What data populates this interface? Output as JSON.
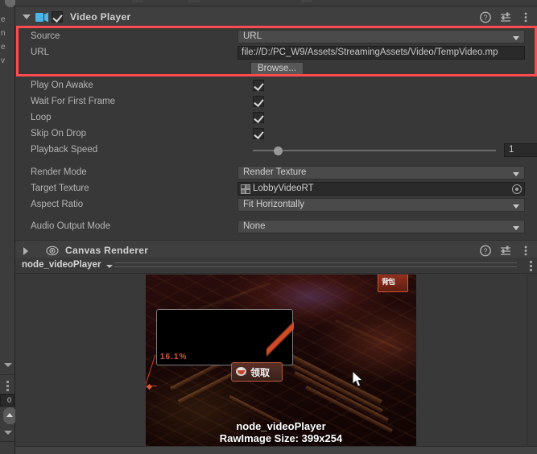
{
  "window": {
    "panel": "inspector",
    "left_strip_letters": [
      "e",
      "n",
      "e",
      "v"
    ],
    "left_strip_value": "0"
  },
  "video_player": {
    "title": "Video Player",
    "enabled": true,
    "icon": "video-player-icon",
    "header_icons": [
      "help-icon",
      "preset-icon",
      "more-menu-icon"
    ],
    "rows": [
      {
        "label": "Source",
        "type": "dropdown",
        "value": "URL"
      },
      {
        "label": "URL",
        "type": "text",
        "value": "file://D:/PC_W9/Assets/StreamingAssets/Video/TempVideo.mp"
      },
      {
        "label": "",
        "type": "button",
        "value": "Browse..."
      },
      {
        "label": "Play On Awake",
        "type": "checkbox",
        "value": true
      },
      {
        "label": "Wait For First Frame",
        "type": "checkbox",
        "value": true
      },
      {
        "label": "Loop",
        "type": "checkbox",
        "value": true
      },
      {
        "label": "Skip On Drop",
        "type": "checkbox",
        "value": true
      },
      {
        "label": "Playback Speed",
        "type": "slider",
        "value": "1"
      },
      {
        "label": "Render Mode",
        "type": "dropdown",
        "value": "Render Texture"
      },
      {
        "label": "Target Texture",
        "type": "object",
        "value": "LobbyVideoRT"
      },
      {
        "label": "Aspect Ratio",
        "type": "dropdown",
        "value": "Fit Horizontally"
      },
      {
        "label": "Audio Output Mode",
        "type": "dropdown",
        "value": "None"
      }
    ]
  },
  "canvas_renderer": {
    "title": "Canvas Renderer",
    "expanded": false,
    "icon": "eye-icon",
    "header_icons": [
      "help-icon",
      "preset-icon",
      "more-menu-icon"
    ]
  },
  "node_bar": {
    "name": "node_videoPlayer",
    "dropdown_arrow": "chevron-down-icon"
  },
  "preview": {
    "overlay_line1": "node_videoPlayer",
    "overlay_line2": "RawImage Size: 399x254",
    "scene_percent": "16.1%",
    "claim_button_text": "领取",
    "badge_text": "背包",
    "cursor": "mouse-cursor-icon"
  },
  "annotation": {
    "highlight_color": "#fd4b50",
    "covers": [
      "Source",
      "URL",
      "Browse..."
    ]
  }
}
